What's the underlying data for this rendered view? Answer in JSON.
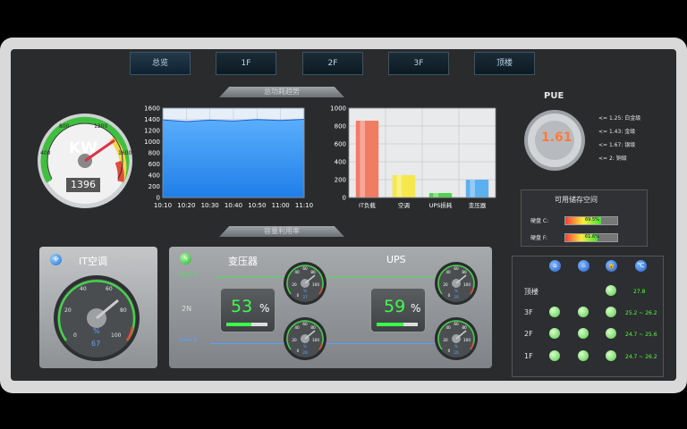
{
  "tabs": [
    {
      "label": "总览",
      "active": true
    },
    {
      "label": "1F",
      "active": false
    },
    {
      "label": "2F",
      "active": false
    },
    {
      "label": "3F",
      "active": false
    },
    {
      "label": "顶楼",
      "active": false
    }
  ],
  "power_trend": {
    "title": "总功耗趋势",
    "gauge_unit": "KW",
    "gauge_value": "1396",
    "gauge_ticks": [
      "400",
      "800",
      "1200",
      "1600"
    ]
  },
  "capacity_title": "容量利用率",
  "pue": {
    "title": "PUE",
    "value": "1.61",
    "levels": [
      "<= 1.25: 白金级",
      "<= 1.43: 金级",
      "<= 1.67: 银级",
      "<= 2: 铜级"
    ]
  },
  "storage": {
    "title": "可用储存空间",
    "disks": [
      {
        "label": "硬盘 C:",
        "percent_text": "69.5%",
        "fill": 0.695
      },
      {
        "label": "硬盘 F:",
        "percent_text": "61.6%",
        "fill": 0.616
      }
    ]
  },
  "it_ac": {
    "title": "IT空调",
    "ticks": [
      "0",
      "20",
      "40",
      "60",
      "80",
      "100"
    ],
    "unit": "%",
    "value": "67"
  },
  "transformer": {
    "title": "变压器",
    "feed_a": "Feed A",
    "feed_b": "Feed B",
    "mode": "2N",
    "value": "53",
    "unit": "%"
  },
  "ups": {
    "title": "UPS",
    "value": "59",
    "unit": "%"
  },
  "mini_gauges": [
    {
      "value": "37"
    },
    {
      "value": "28"
    },
    {
      "value": "30"
    },
    {
      "value": "26"
    }
  ],
  "mini_gauge_ticks": [
    "20",
    "40",
    "60",
    "80",
    "100",
    "0",
    "%"
  ],
  "floors": {
    "rows": [
      {
        "label": "顶楼",
        "vals": "27.8"
      },
      {
        "label": "3F",
        "vals": "25.2  ~  26.2"
      },
      {
        "label": "2F",
        "vals": "24.7  ~  25.6"
      },
      {
        "label": "1F",
        "vals": "24.7  ~  26.2"
      }
    ],
    "icons": [
      "home-icon",
      "thermo-icon",
      "lock-icon",
      "celsius-icon"
    ],
    "icon_glyphs": [
      "⌂",
      "♨",
      "🔒",
      "℃"
    ]
  },
  "chart_data": [
    {
      "type": "area",
      "x": [
        "10:10",
        "10:20",
        "10:30",
        "10:40",
        "10:50",
        "11:00",
        "11:10"
      ],
      "ylim": [
        0,
        1600
      ],
      "yticks": [
        "0",
        "200",
        "400",
        "600",
        "800",
        "1000",
        "1200",
        "1400",
        "1600"
      ],
      "series": [
        {
          "values": [
            1390,
            1360,
            1385,
            1370,
            1395,
            1380,
            1400
          ]
        }
      ]
    },
    {
      "type": "bar",
      "categories": [
        "IT负载",
        "空调",
        "UPS损耗",
        "变压器"
      ],
      "values": [
        860,
        250,
        50,
        200
      ],
      "ylim": [
        0,
        1000
      ],
      "yticks": [
        "0",
        "200",
        "400",
        "600",
        "800",
        "1000"
      ],
      "colors": [
        "#f07c64",
        "#f5e84b",
        "#4fd44c",
        "#5cb0f0"
      ]
    }
  ]
}
